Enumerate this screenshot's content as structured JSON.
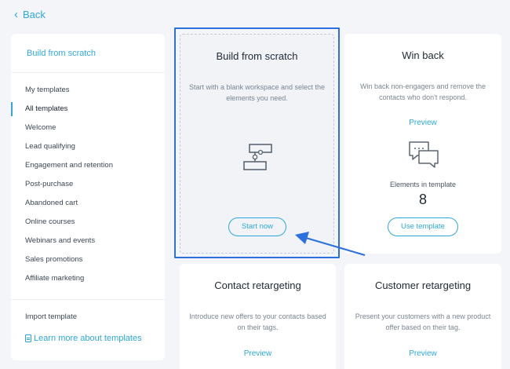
{
  "back": {
    "label": "Back"
  },
  "sidebar": {
    "top_link": "Build from scratch",
    "items": [
      {
        "label": "My templates"
      },
      {
        "label": "All templates"
      },
      {
        "label": "Welcome"
      },
      {
        "label": "Lead qualifying"
      },
      {
        "label": "Engagement and retention"
      },
      {
        "label": "Post-purchase"
      },
      {
        "label": "Abandoned cart"
      },
      {
        "label": "Online courses"
      },
      {
        "label": "Webinars and events"
      },
      {
        "label": "Sales promotions"
      },
      {
        "label": "Affiliate marketing"
      }
    ],
    "active_item": "All templates",
    "import": "Import template",
    "learn": "Learn more about templates"
  },
  "cards": {
    "scratch": {
      "title": "Build from scratch",
      "desc": "Start with a blank workspace and select the elements you need.",
      "button": "Start now"
    },
    "winback": {
      "title": "Win back",
      "desc": "Win back non-engagers and remove the contacts who don't respond.",
      "preview": "Preview",
      "elements_label": "Elements in template",
      "elements_count": "8",
      "button": "Use template"
    },
    "contact": {
      "title": "Contact retargeting",
      "desc": "Introduce new offers to your contacts based on their tags.",
      "preview": "Preview"
    },
    "customer": {
      "title": "Customer retargeting",
      "desc": "Present your customers with a new product offer based on their tag.",
      "preview": "Preview"
    }
  },
  "colors": {
    "accent": "#2ea8dc",
    "highlight": "#2b6fe0",
    "background": "#f3f5f8"
  }
}
